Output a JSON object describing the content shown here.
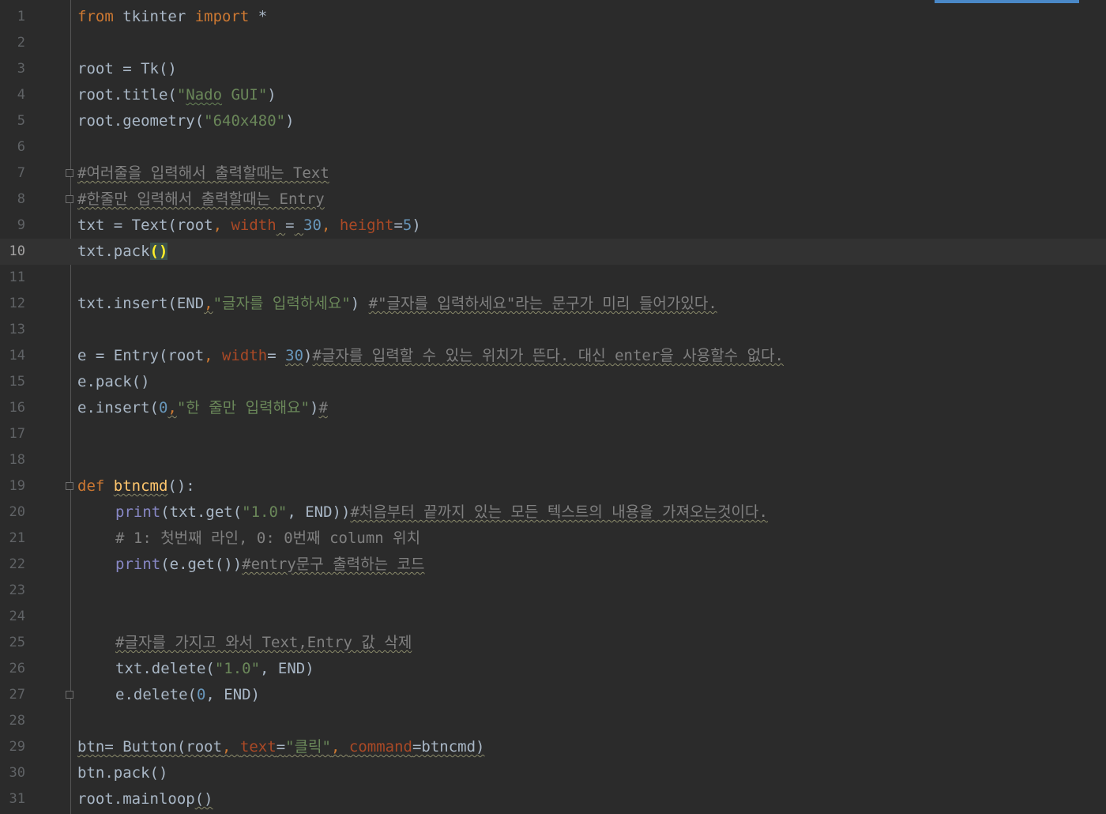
{
  "editor": {
    "language": "python",
    "current_line": 10,
    "lines": [
      {
        "n": "1",
        "code": "from tkinter import *"
      },
      {
        "n": "2",
        "code": ""
      },
      {
        "n": "3",
        "code": "root = Tk()"
      },
      {
        "n": "4",
        "code": "root.title(\"Nado GUI\")"
      },
      {
        "n": "5",
        "code": "root.geometry(\"640x480\")"
      },
      {
        "n": "6",
        "code": ""
      },
      {
        "n": "7",
        "code": "#여러줄을 입력해서 출력할때는 Text"
      },
      {
        "n": "8",
        "code": "#한줄만 입력해서 출력할때는 Entry"
      },
      {
        "n": "9",
        "code": "txt = Text(root, width = 30, height=5)"
      },
      {
        "n": "10",
        "code": "txt.pack()"
      },
      {
        "n": "11",
        "code": ""
      },
      {
        "n": "12",
        "code": "txt.insert(END,\"글자를 입력하세요\") #\"글자를 입력하세요\"라는 문구가 미리 들어가있다."
      },
      {
        "n": "13",
        "code": ""
      },
      {
        "n": "14",
        "code": "e = Entry(root, width= 30)#글자를 입력할 수 있는 위치가 뜬다. 대신 enter을 사용할수 없다."
      },
      {
        "n": "15",
        "code": "e.pack()"
      },
      {
        "n": "16",
        "code": "e.insert(0,\"한 줄만 입력해요\")#"
      },
      {
        "n": "17",
        "code": ""
      },
      {
        "n": "18",
        "code": ""
      },
      {
        "n": "19",
        "code": "def btncmd():"
      },
      {
        "n": "20",
        "code": "    print(txt.get(\"1.0\", END))#처음부터 끝까지 있는 모든 텍스트의 내용을 가져오는것이다."
      },
      {
        "n": "21",
        "code": "    # 1: 첫번째 라인, 0: 0번째 column 위치"
      },
      {
        "n": "22",
        "code": "    print(e.get())#entry문구 출력하는 코드"
      },
      {
        "n": "23",
        "code": ""
      },
      {
        "n": "24",
        "code": ""
      },
      {
        "n": "25",
        "code": "    #글자를 가지고 와서 Text,Entry 값 삭제"
      },
      {
        "n": "26",
        "code": "    txt.delete(\"1.0\", END)"
      },
      {
        "n": "27",
        "code": "    e.delete(0, END)"
      },
      {
        "n": "28",
        "code": ""
      },
      {
        "n": "29",
        "code": "btn= Button(root, text=\"클릭\", command=btncmd)"
      },
      {
        "n": "30",
        "code": "btn.pack()"
      },
      {
        "n": "31",
        "code": "root.mainloop()"
      }
    ]
  },
  "tokens": {
    "l1": [
      "from",
      " tkinter ",
      "import",
      " *"
    ],
    "l3": [
      "root = Tk()"
    ],
    "l4": [
      "root.title(",
      "\"",
      "Nado",
      " GUI\"",
      ")"
    ],
    "l5": [
      "root.geometry(",
      "\"640x480\"",
      ")"
    ],
    "l7": [
      "#여러줄을 입력해서 출력할때는 Text"
    ],
    "l8": [
      "#한줄만 입력해서 출력할때는 Entry"
    ],
    "l9": [
      "txt = Text(root",
      ", ",
      "width",
      " ",
      "=",
      " ",
      "30",
      ", ",
      "height",
      "=",
      "5",
      ")"
    ],
    "l10": [
      "txt.pack",
      "()"
    ],
    "l12": [
      "txt.insert(END",
      ",",
      "\"글자를 입력하세요\"",
      ") ",
      "#\"글자를 입력하세요\"라는 문구가 미리 들어가있다."
    ],
    "l14": [
      "e = Entry(root",
      ", ",
      "width",
      "= ",
      "30",
      ")",
      "#글자를 입력할 수 있는 위치가 뜬다. 대신 enter을 사용할수 없다."
    ],
    "l15": [
      "e.pack()"
    ],
    "l16": [
      "e.insert(",
      "0",
      ",",
      "\"한 줄만 입력해요\"",
      ")",
      "#"
    ],
    "l19": [
      "def",
      " ",
      "btncmd",
      "():"
    ],
    "l20": [
      "print",
      "(txt.get(",
      "\"1.0\"",
      ", END))",
      "#처음부터 끝까지 있는 모든 텍스트의 내용을 가져오는것이다."
    ],
    "l21": [
      "# 1: 첫번째 라인, 0: 0번째 column 위치"
    ],
    "l22": [
      "print",
      "(e.get())",
      "#entry문구 출력하는 코드"
    ],
    "l25": [
      "#글자를 가지고 와서 Text,Entry 값 삭제"
    ],
    "l26": [
      "txt.delete(",
      "\"1.0\"",
      ", END)"
    ],
    "l27": [
      "e.delete(",
      "0",
      ", END)"
    ],
    "l29": [
      "btn= Button(root",
      ", ",
      "text",
      "=",
      "\"클릭\"",
      ", ",
      "command",
      "=btncmd)"
    ],
    "l30": [
      "btn.pack()"
    ],
    "l31": [
      "root.mainloop",
      "()"
    ]
  },
  "colors": {
    "background": "#2b2b2b",
    "current_line": "#323232",
    "keyword": "#cc7832",
    "string": "#6a8759",
    "number": "#6897bb",
    "named_param": "#aa4926",
    "comment": "#808080",
    "function_def": "#ffc66d",
    "builtin": "#8888c6",
    "default_text": "#a9b7c6",
    "scroll_indicator": "#4a88c7"
  },
  "icons": {
    "fold_marker": "fold-icon"
  }
}
